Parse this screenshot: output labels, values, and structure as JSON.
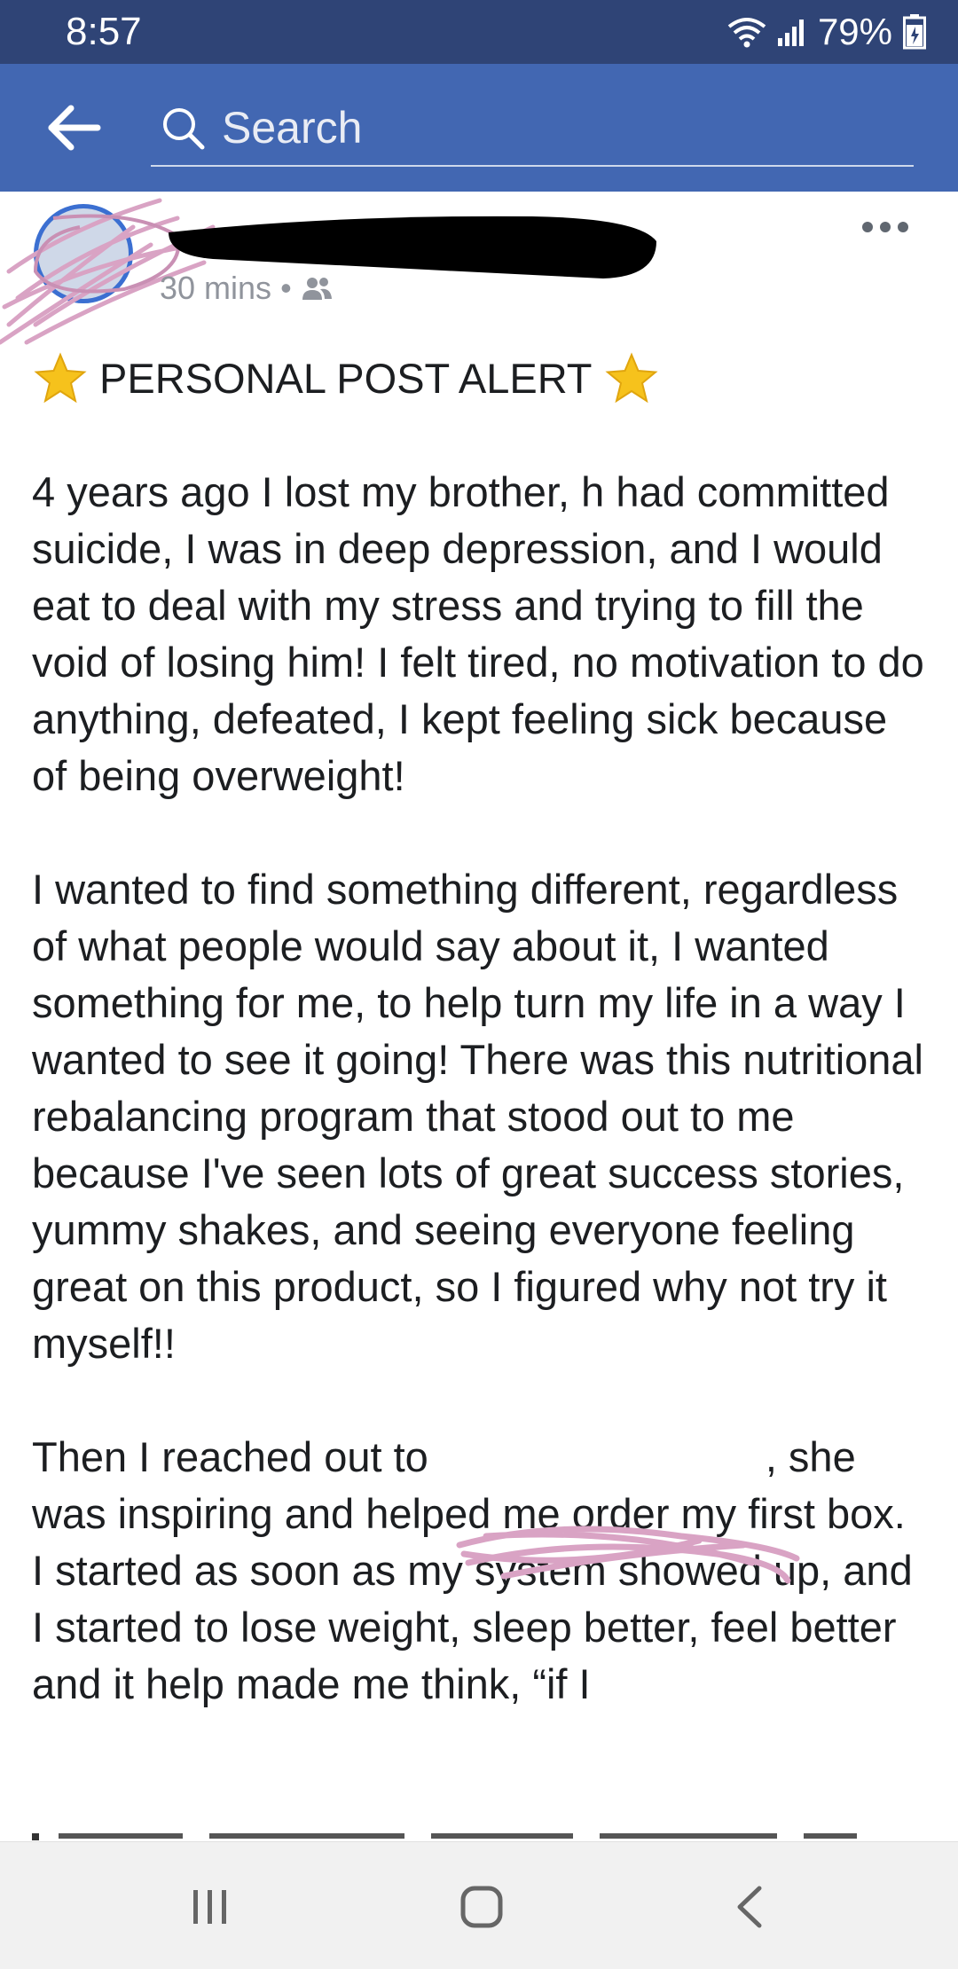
{
  "status_bar": {
    "time": "8:57",
    "battery": "79%",
    "icons": [
      "wifi-icon",
      "signal-icon",
      "battery-charging-icon"
    ]
  },
  "app_bar": {
    "search_placeholder": "Search",
    "back_icon": "arrow-left-icon",
    "search_icon": "search-icon"
  },
  "post": {
    "time_ago": "30 mins",
    "separator": "•",
    "audience_icon": "friends-icon",
    "title": "PERSONAL POST ALERT",
    "paragraph_1": "4 years ago I lost my brother, h had committed suicide, I was in deep depression, and I would eat to deal with my stress and trying to fill the void of losing him! I felt tired, no motivation to do anything, defeated, I kept feeling sick because of being overweight!",
    "paragraph_2": "I wanted to find something different, regardless of what people would say about it, I wanted something for me, to help turn my life in a way I wanted to see it going! There was this nutritional rebalancing program that stood out to me because I've seen lots of great success stories, yummy shakes, and seeing everyone feeling great on this product, so I figured why not try it myself!!",
    "paragraph_3_before": "Then I reached out to",
    "paragraph_3_after": ", she was inspiring and helped me order my first box. I started as soon as my system showed up, and I started to lose weight, sleep better, feel better and it help made me think, “if I"
  },
  "colors": {
    "status_bar": "#2f4476",
    "app_bar": "#4267b2",
    "text": "#1c1e21",
    "meta": "#90949c",
    "redaction_scribble": "#d9a3c4",
    "nav_bar": "#f1f1f1"
  }
}
